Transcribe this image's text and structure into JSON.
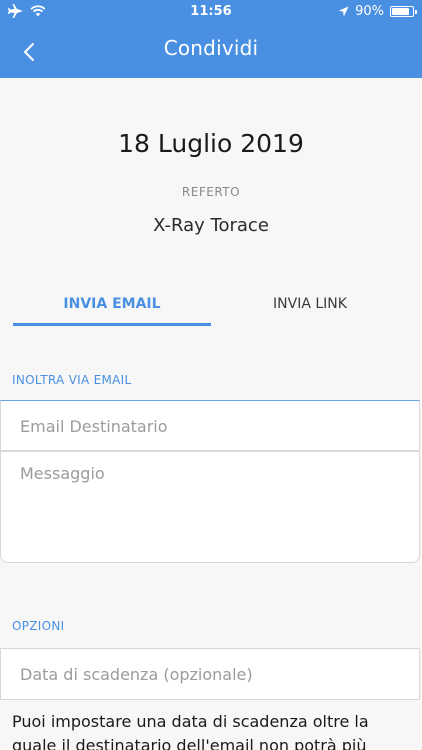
{
  "status_bar": {
    "time": "11:56",
    "battery_percent": "90%",
    "battery_level": 0.9
  },
  "header": {
    "title": "Condividi",
    "back_icon": "chevron-left-icon",
    "background": "#4a90e2"
  },
  "report": {
    "date": "18 Luglio 2019",
    "label": "REFERTO",
    "name": "X-Ray Torace"
  },
  "tabs": [
    {
      "label": "INVIA EMAIL",
      "active": true
    },
    {
      "label": "INVIA LINK",
      "active": false
    }
  ],
  "email_section": {
    "label": "INOLTRA VIA EMAIL",
    "recipient_placeholder": "Email Destinatario",
    "message_placeholder": "Messaggio"
  },
  "options_section": {
    "label": "OPZIONI",
    "expiry_placeholder": "Data di scadenza (opzionale)",
    "info_text": "Puoi impostare una data di scadenza oltre la quale il destinatario dell'email non potrà più"
  },
  "colors": {
    "accent": "#4a90e2"
  }
}
